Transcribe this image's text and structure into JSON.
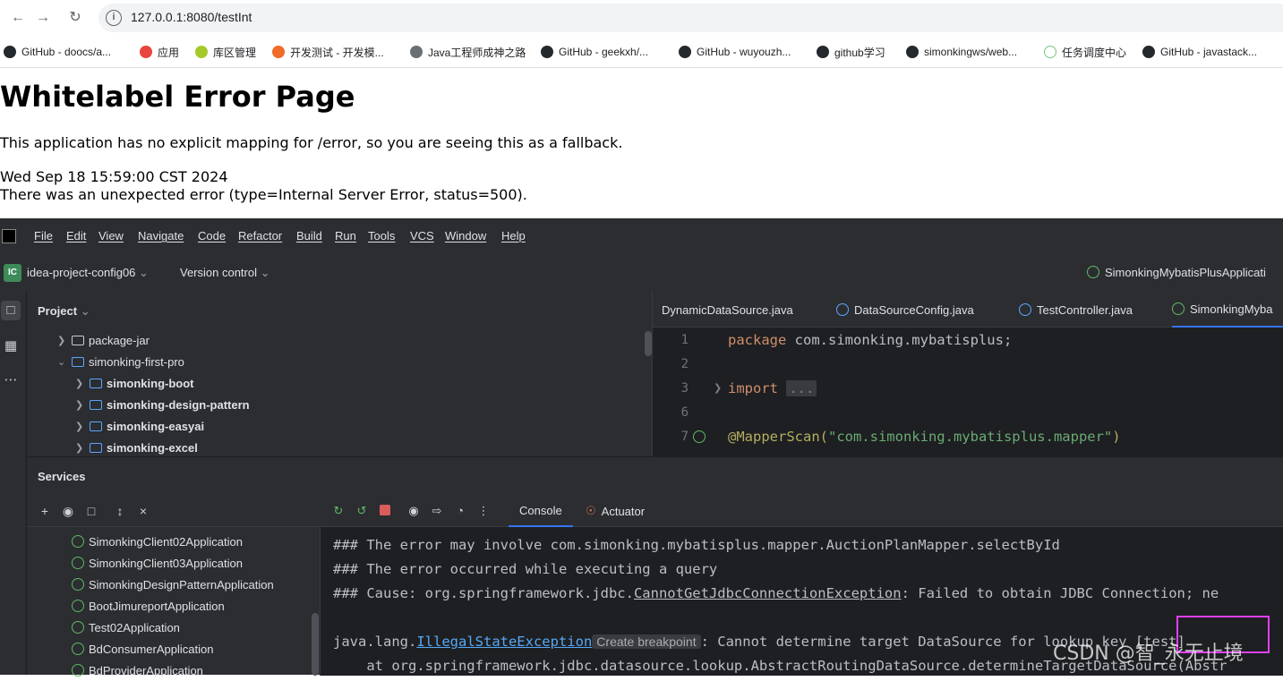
{
  "browser": {
    "url": "127.0.0.1:8080/testInt",
    "bookmarks": [
      "GitHub - doocs/a...",
      "应用",
      "库区管理",
      "开发测试 - 开发模...",
      "Java工程师成神之路",
      "GitHub - geekxh/...",
      "GitHub - wuyouzh...",
      "github学习",
      "simonkingws/web...",
      "任务调度中心",
      "GitHub - javastack..."
    ]
  },
  "page": {
    "title": "Whitelabel Error Page",
    "message": "This application has no explicit mapping for /error, so you are seeing this as a fallback.",
    "timestamp": "Wed Sep 18 15:59:00 CST 2024",
    "error": "There was an unexpected error (type=Internal Server Error, status=500)."
  },
  "ide": {
    "menu": [
      "File",
      "Edit",
      "View",
      "Navigate",
      "Code",
      "Refactor",
      "Build",
      "Run",
      "Tools",
      "VCS",
      "Window",
      "Help"
    ],
    "project_badge": "IC",
    "project_name": "idea-project-config06",
    "version_control": "Version control",
    "run_config": "SimonkingMybatisPlusApplicati",
    "project_panel_title": "Project",
    "tree": [
      "package-jar",
      "simonking-first-pro",
      "simonking-boot",
      "simonking-design-pattern",
      "simonking-easyai",
      "simonking-excel"
    ],
    "editor_tabs": [
      "DynamicDataSource.java",
      "DataSourceConfig.java",
      "TestController.java",
      "SimonkingMyba"
    ],
    "code_lines": {
      "n1": "1",
      "n2": "2",
      "n3": "3",
      "n6": "6",
      "n7": "7",
      "l1_kw": "package",
      "l1_rest": " com.simonking.mybatisplus;",
      "l3_kw": "import",
      "l3_fold": "...",
      "l7_ann": "@MapperScan(",
      "l7_str": "\"com.simonking.mybatisplus.mapper\"",
      "l7_end": ")"
    },
    "services_title": "Services",
    "services": [
      "SimonkingClient02Application",
      "SimonkingClient03Application",
      "SimonkingDesignPatternApplication",
      "BootJimureportApplication",
      "Test02Application",
      "BdConsumerApplication",
      "BdProviderApplication"
    ],
    "console_tabs": [
      "Console",
      "Actuator"
    ],
    "console": {
      "line1": "### The error may involve com.simonking.mybatisplus.mapper.AuctionPlanMapper.selectById",
      "line2": "### The error occurred while executing a query",
      "line3_pre": "### Cause: org.springframework.jdbc.",
      "line3_link": "CannotGetJdbcConnectionException",
      "line3_post": ": Failed to obtain JDBC Connection; ne",
      "line4_pre": "java.lang.",
      "line4_link": "IllegalStateException",
      "line4_chip": "Create breakpoint",
      "line4_post": ": Cannot determine target DataSource for lookup key [test]",
      "line5": "    at org.springframework.jdbc.datasource.lookup.AbstractRoutingDataSource.determineTargetDataSource(Abstr"
    }
  },
  "watermark": "CSDN @智_永无止境",
  "colors": {
    "accent": "#3574f0",
    "highlight": "#e040fb"
  }
}
